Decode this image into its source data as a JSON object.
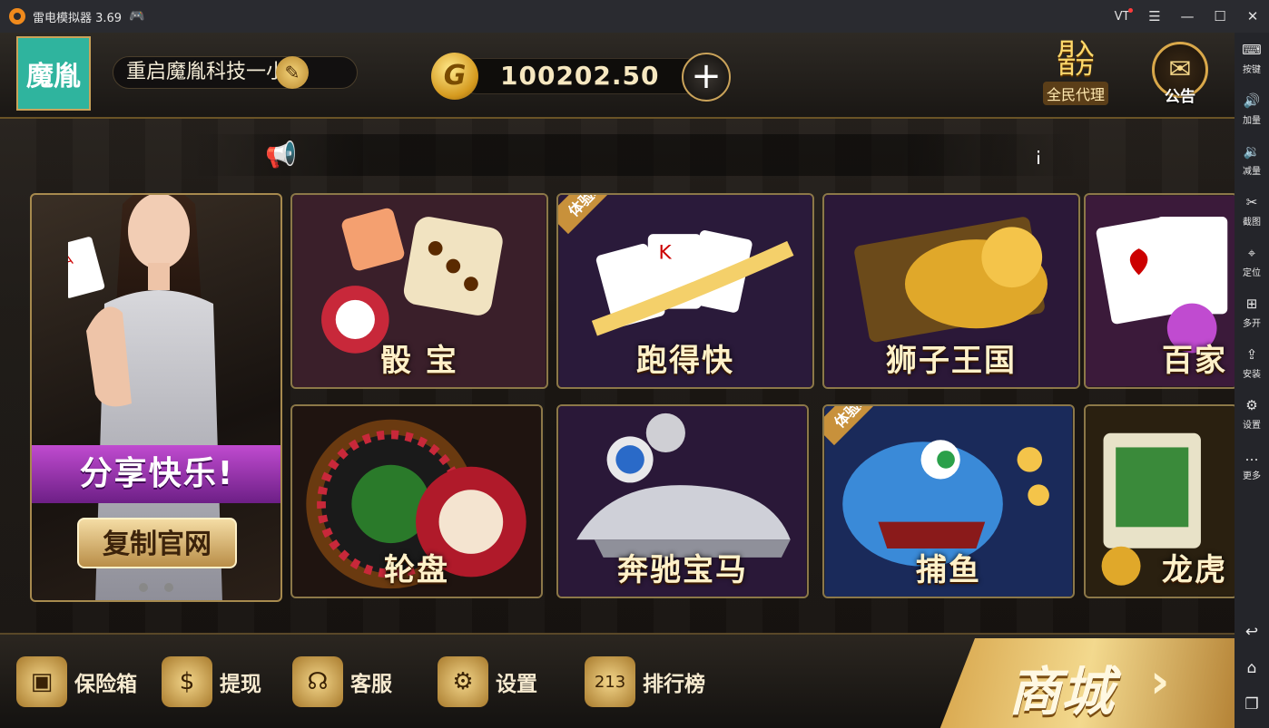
{
  "window": {
    "title": "雷电模拟器 3.69",
    "vt_label": "VT",
    "controls": [
      "☰",
      "—",
      "☐",
      "✕"
    ]
  },
  "sidebar": {
    "items": [
      {
        "icon": "keyboard-icon",
        "glyph": "⌨",
        "label": "按键"
      },
      {
        "icon": "volume-up-icon",
        "glyph": "🔊",
        "label": "加量"
      },
      {
        "icon": "volume-down-icon",
        "glyph": "🔉",
        "label": "减量"
      },
      {
        "icon": "scissors-icon",
        "glyph": "✂",
        "label": "截图"
      },
      {
        "icon": "location-icon",
        "glyph": "⌖",
        "label": "定位"
      },
      {
        "icon": "multi-open-icon",
        "glyph": "⊞",
        "label": "多开"
      },
      {
        "icon": "apk-install-icon",
        "glyph": "⇪",
        "label": "安装"
      },
      {
        "icon": "gear-icon",
        "glyph": "⚙",
        "label": "设置"
      },
      {
        "icon": "more-icon",
        "glyph": "…",
        "label": "更多"
      }
    ],
    "nav": [
      {
        "icon": "back-icon",
        "glyph": "↩"
      },
      {
        "icon": "home-icon",
        "glyph": "⌂"
      },
      {
        "icon": "recent-apps-icon",
        "glyph": "❐"
      }
    ]
  },
  "header": {
    "avatar_text": "魔胤",
    "nickname": "重启魔胤科技一小杨",
    "coin_symbol": "G",
    "balance": "100202.50",
    "add_label": "+",
    "agent_line1": "月入",
    "agent_line2": "百万",
    "agent_caption": "全民代理",
    "notice_label": "公告"
  },
  "promo": {
    "share_text": "分享快乐!",
    "copy_button": "复制官网"
  },
  "games": [
    {
      "name": "骰 宝",
      "badge": ""
    },
    {
      "name": "跑得快",
      "badge": "体验场"
    },
    {
      "name": "狮子王国",
      "badge": ""
    },
    {
      "name": "百家",
      "badge": ""
    },
    {
      "name": "轮盘",
      "badge": ""
    },
    {
      "name": "奔驰宝马",
      "badge": ""
    },
    {
      "name": "捕鱼",
      "badge": "体验场"
    },
    {
      "name": "龙虎",
      "badge": ""
    }
  ],
  "bottom": {
    "items": [
      {
        "icon": "safe-icon",
        "glyph": "▣",
        "label": "保险箱"
      },
      {
        "icon": "coins-icon",
        "glyph": "$",
        "label": "提现"
      },
      {
        "icon": "headset-icon",
        "glyph": "☊",
        "label": "客服"
      },
      {
        "icon": "gear-icon",
        "glyph": "⚙",
        "label": "设置"
      },
      {
        "icon": "podium-icon",
        "glyph": "213",
        "label": "排行榜"
      }
    ],
    "shop_label": "商城",
    "shop_arrow": "›"
  }
}
